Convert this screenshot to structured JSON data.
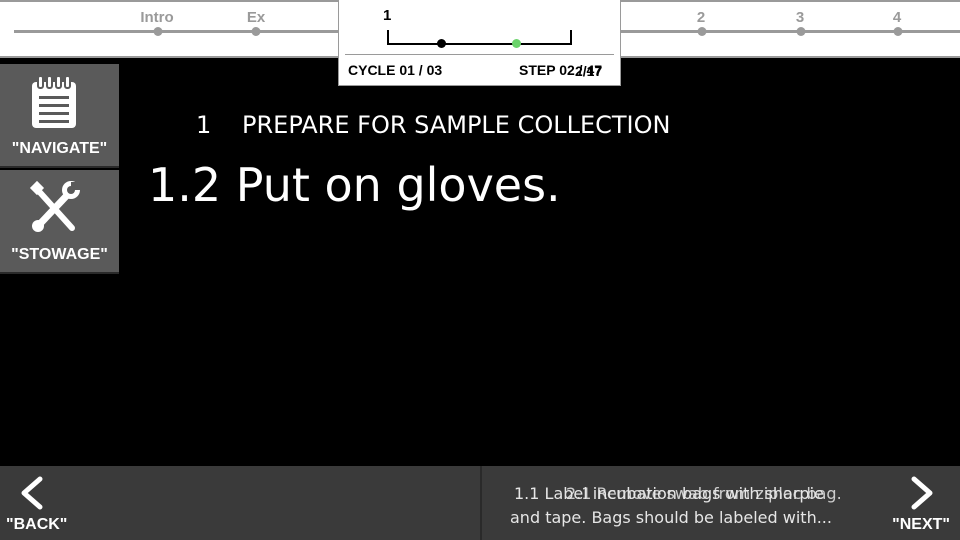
{
  "timeline": {
    "labels": {
      "intro": "Intro",
      "ex": "Ex",
      "s2": "2",
      "s3": "3",
      "s4": "4"
    },
    "current": {
      "section": "1",
      "cycle": "CYCLE 01 / 03",
      "step": "STEP 02 / 47",
      "step_overlay": "2/17"
    }
  },
  "sidebar": {
    "navigate_label": "\"NAVIGATE\"",
    "stowage_label": "\"STOWAGE\""
  },
  "main": {
    "section_number": "1",
    "section_title": "PREPARE FOR SAMPLE COLLECTION",
    "step_title": "1.2 Put on gloves."
  },
  "bottom": {
    "back_label": "\"BACK\"",
    "next_label": "\"NEXT\"",
    "preview_line1": "1.1 Label incubation bags with sharpie",
    "preview_line2": "and tape. Bags should be labeled with...",
    "preview_overlay": "2.1 Remove swab from ziploc bag."
  },
  "colors": {
    "background": "#000000",
    "sidebar_button": "#5a5a5a",
    "bottom_bar": "#3a3a3a",
    "timeline_gray": "#9a9a9a",
    "current_step_dot": "#6ad36a"
  },
  "icons": {
    "navigate": "notepad-icon",
    "stowage": "tools-icon",
    "back": "chevron-left-icon",
    "next": "chevron-right-icon"
  }
}
